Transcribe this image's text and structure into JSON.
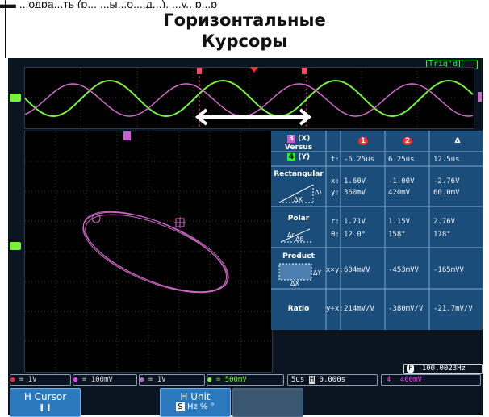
{
  "header_fragment": "▄▄   ...одра...ть (р...    ...ы...о....д...). ...у.. р...р",
  "title_line1": "Горизонтальные",
  "title_line2": "Курсоры",
  "trigger_status": "Trig'd",
  "colors": {
    "ch1": "#ff2727",
    "ch2": "#ff3bff",
    "ch3": "#cf5ad9",
    "ch4": "#23f232",
    "wave_green": "#76f23b",
    "wave_pink": "#d06ac8",
    "screen_bg": "#0b1522",
    "table_bg": "#1b4d7a",
    "softkey_bg": "#2c78bd"
  },
  "table": {
    "xy_header": {
      "top_num": "3",
      "top_unit": "(X)",
      "versus": "Versus",
      "bot_num": "4",
      "bot_unit": "(Y)"
    },
    "col_headers": [
      "1",
      "2",
      "Δ"
    ],
    "t_row": {
      "label": "t:",
      "v1": "-6.25us",
      "v2": "6.25us",
      "vd": "12.5us"
    },
    "rectangular": {
      "label": "Rectangular",
      "x_label": "x:",
      "x1": "1.60V",
      "x2": "-1.00V",
      "xd": "-2.76V",
      "y_label": "y:",
      "y1": "360mV",
      "y2": "420mV",
      "yd": "60.0mV"
    },
    "polar": {
      "label": "Polar",
      "r_label": "r:",
      "r1": "1.71V",
      "r2": "1.15V",
      "rd": "2.76V",
      "th_label": "θ:",
      "t1": "12.0°",
      "t2": "158°",
      "td": "178°"
    },
    "product": {
      "label": "Product",
      "label_row": "x×y:",
      "v1": "604mVV",
      "v2": "-453mVV",
      "vd": "-165mVV"
    },
    "ratio": {
      "label": "Ratio",
      "label_row": "y÷x:",
      "v1": "214mV/V",
      "v2": "-380mV/V",
      "vd": "-21.7mV/V"
    }
  },
  "freq_readout": {
    "badge": "F",
    "value": "100.0023Hz"
  },
  "status_bar": {
    "ch1": "1V",
    "ch2": "100mV",
    "ch3": "1V",
    "ch4": "500mV",
    "timebase": "5us",
    "h_icon": "H",
    "position": "0.000s",
    "trig_source": "4",
    "trig_level": "400mV"
  },
  "softkeys": {
    "h_cursor": {
      "label": "H Cursor",
      "value": "I I"
    },
    "h_unit": {
      "label": "H Unit",
      "selected": "S",
      "options": "Hz % °"
    }
  }
}
